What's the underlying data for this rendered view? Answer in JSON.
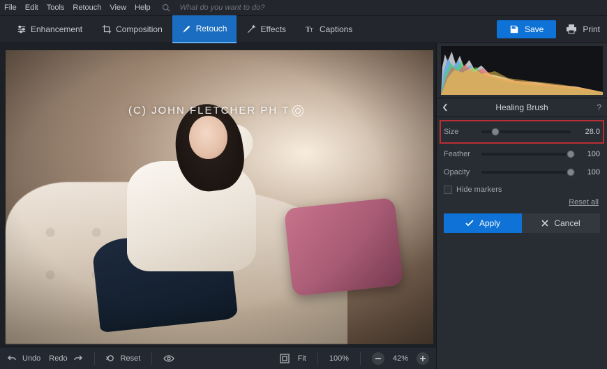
{
  "menu": {
    "items": [
      "File",
      "Edit",
      "Tools",
      "Retouch",
      "View",
      "Help"
    ],
    "search_placeholder": "What do you want to do?"
  },
  "toolbar": {
    "tabs": [
      {
        "label": "Enhancement"
      },
      {
        "label": "Composition"
      },
      {
        "label": "Retouch",
        "active": true
      },
      {
        "label": "Effects"
      },
      {
        "label": "Captions"
      }
    ],
    "save_label": "Save",
    "print_label": "Print"
  },
  "canvas": {
    "watermark": "(C) JOHN FLETCHER PH  T"
  },
  "bottombar": {
    "undo": "Undo",
    "redo": "Redo",
    "reset": "Reset",
    "fit": "Fit",
    "zoom_pct": "100%",
    "zoom_out_pct": "42%"
  },
  "panel": {
    "title": "Healing Brush",
    "sliders": [
      {
        "label": "Size",
        "value": "28.0",
        "pct": 16,
        "highlight": true
      },
      {
        "label": "Feather",
        "value": "100",
        "pct": 100
      },
      {
        "label": "Opacity",
        "value": "100",
        "pct": 100
      }
    ],
    "hide_markers": "Hide markers",
    "reset_all": "Reset all",
    "apply": "Apply",
    "cancel": "Cancel"
  }
}
